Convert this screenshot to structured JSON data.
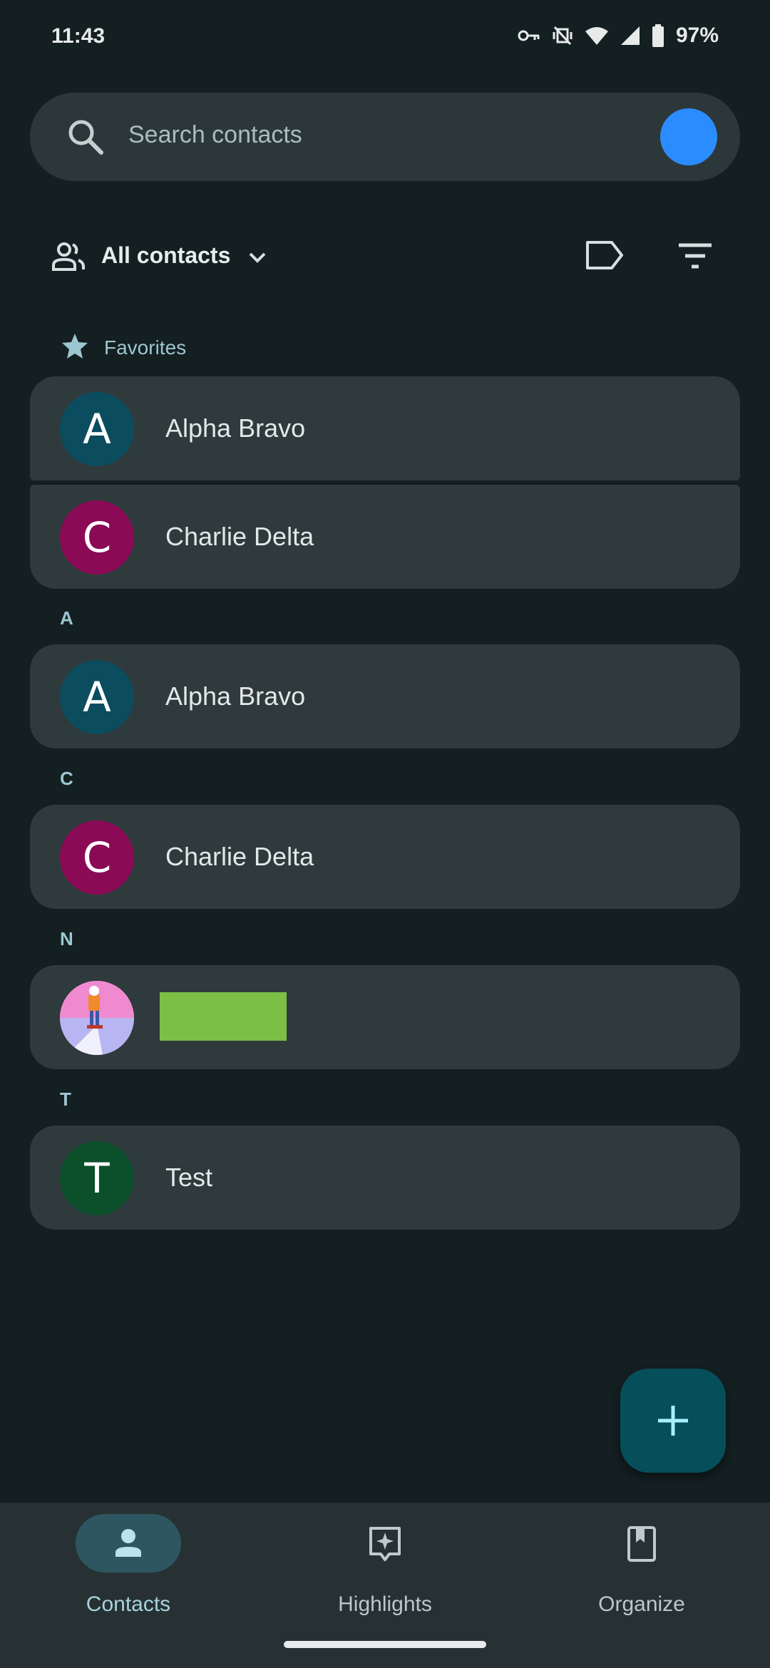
{
  "status_bar": {
    "time": "11:43",
    "battery": "97%"
  },
  "search": {
    "placeholder": "Search contacts"
  },
  "filter": {
    "label": "All contacts"
  },
  "favorites": {
    "title": "Favorites",
    "items": [
      {
        "initial": "A",
        "name": "Alpha Bravo",
        "color": "#0b4c5f"
      },
      {
        "initial": "C",
        "name": "Charlie Delta",
        "color": "#8b0a56"
      }
    ]
  },
  "sections": [
    {
      "letter": "A",
      "contacts": [
        {
          "initial": "A",
          "name": "Alpha Bravo",
          "color": "#0b4c5f"
        }
      ]
    },
    {
      "letter": "C",
      "contacts": [
        {
          "initial": "C",
          "name": "Charlie Delta",
          "color": "#8b0a56"
        }
      ]
    },
    {
      "letter": "N",
      "contacts": [
        {
          "initial": "",
          "name": "",
          "color": "#f08ad0"
        }
      ]
    },
    {
      "letter": "T",
      "contacts": [
        {
          "initial": "T",
          "name": "Test",
          "color": "#0b4f2b"
        }
      ]
    }
  ],
  "nav": {
    "items": [
      {
        "label": "Contacts",
        "icon": "person-icon",
        "active": true
      },
      {
        "label": "Highlights",
        "icon": "sparkle-icon",
        "active": false
      },
      {
        "label": "Organize",
        "icon": "bookmark-icon",
        "active": false
      }
    ]
  },
  "colors": {
    "background": "#141f21",
    "card": "#2f3a3c",
    "accent": "#9cc7d1",
    "fab": "#064f5a",
    "account_avatar": "#2b8cff",
    "redaction": "#7cbf46"
  }
}
